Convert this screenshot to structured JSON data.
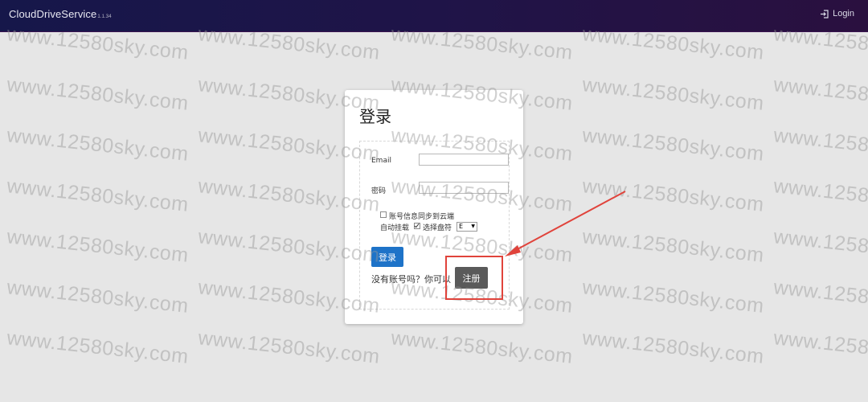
{
  "header": {
    "brand": "CloudDriveService",
    "version": "1.1.34",
    "login_label": "Login",
    "login_icon": "sign-in-icon"
  },
  "watermark": "www.12580sky.com",
  "login_card": {
    "title": "登录",
    "email_label": "Email",
    "email_value": "",
    "password_label": "密码",
    "password_value": "",
    "sync_label": "账号信息同步到云端",
    "sync_checked": false,
    "automount_label": "自动挂载",
    "automount_checked": true,
    "drive_label": "选择盘符",
    "drive_value": "E",
    "login_button": "登录",
    "no_account_text": "没有账号吗？你可以",
    "register_button": "注册"
  },
  "colors": {
    "header_bg": "#1c1648",
    "login_button": "#1e73c8",
    "register_button": "#5a5a5a",
    "annotation": "#e0433b"
  }
}
